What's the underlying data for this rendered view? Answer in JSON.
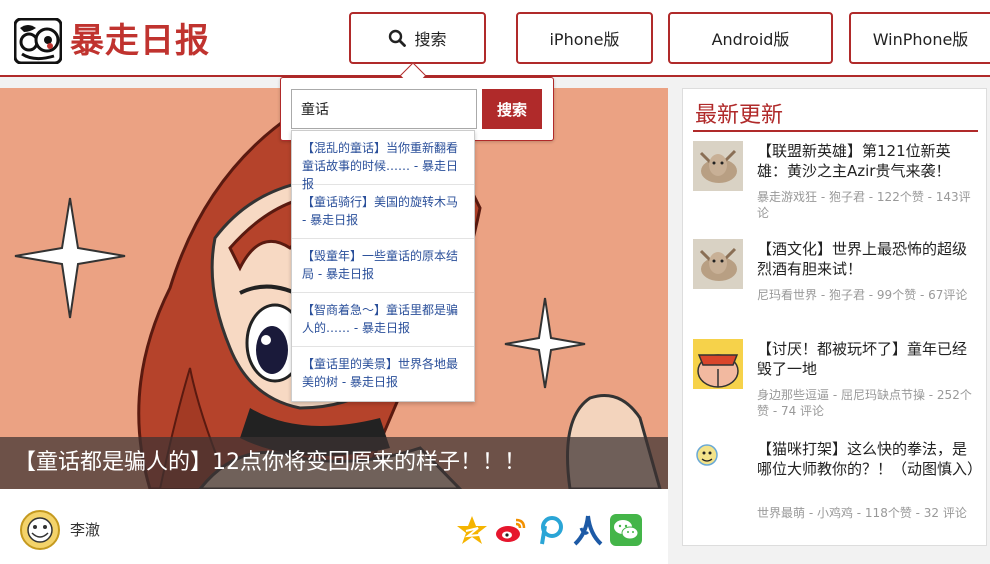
{
  "header": {
    "logo_text": "暴走日报",
    "nav": {
      "search_label": "搜索",
      "iphone_label": "iPhone版",
      "android_label": "Android版",
      "winphone_label": "WinPhone版"
    }
  },
  "search": {
    "value": "童话",
    "submit_label": "搜索",
    "suggestions": [
      "【混乱的童话】当你重新翻看童话故事的时候…… - 暴走日报",
      "【童话骑行】美国的旋转木马 - 暴走日报",
      "【毁童年】一些童话的原本结局 - 暴走日报",
      "【智商着急～】童话里都是骗人的…… - 暴走日报",
      "【童话里的美景】世界各地最美的树 - 暴走日报"
    ]
  },
  "hero": {
    "caption": "【童话都是骗人的】12点你将变回原来的样子！！！",
    "author": "李澈"
  },
  "share_icons": [
    "qzone-icon",
    "weibo-icon",
    "pinterest-icon",
    "renren-icon",
    "wechat-icon"
  ],
  "sidebar": {
    "title": "最新更新",
    "items": [
      {
        "title": "【联盟新英雄】第121位新英雄：黄沙之主Azir贵气来袭！",
        "meta": "暴走游戏狂 - 狍子君 - 122个赞 - 143评论"
      },
      {
        "title": "【酒文化】世界上最恐怖的超级烈酒有胆来试！",
        "meta": "尼玛看世界 - 狍子君 - 99个赞 - 67评论"
      },
      {
        "title": "【讨厌！都被玩坏了】童年已经毁了一地",
        "meta": "身边那些逗逼 - 屈尼玛缺点节操 - 252个赞 - 74 评论"
      },
      {
        "title": "【猫咪打架】这么快的拳法，是哪位大师教你的？！（动图慎入）",
        "meta": "世界最萌 - 小鸡鸡 - 118个赞 - 32 评论"
      }
    ]
  },
  "colors": {
    "accent": "#b02a2a",
    "link": "#2a4f9a",
    "muted": "#999999"
  }
}
